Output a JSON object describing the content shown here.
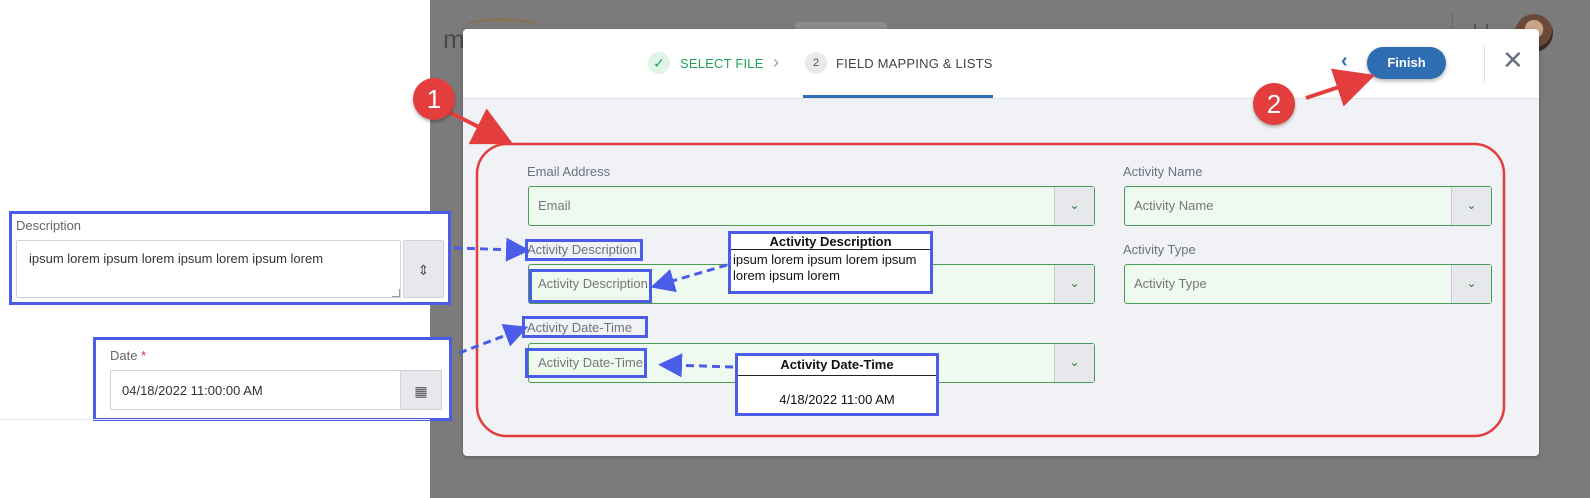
{
  "background_app": {
    "logo_text": "m"
  },
  "wizard": {
    "step1_label": "SELECT FILE",
    "step2_number": "2",
    "step2_label": "FIELD MAPPING & LISTS",
    "finish_label": "Finish"
  },
  "form": {
    "email": {
      "label": "Email Address",
      "placeholder": "Email"
    },
    "activity_name": {
      "label": "Activity Name",
      "placeholder": "Activity Name"
    },
    "activity_description": {
      "label": "Activity Description",
      "placeholder": "Activity Description"
    },
    "activity_type": {
      "label": "Activity Type",
      "placeholder": "Activity Type"
    },
    "activity_datetime": {
      "label": "Activity Date-Time",
      "placeholder": "Activity Date-Time"
    }
  },
  "source_panel": {
    "description_label": "Description",
    "description_value": "ipsum lorem ipsum lorem ipsum lorem ipsum lorem",
    "date_label": "Date",
    "date_required": "*",
    "date_value": "04/18/2022 11:00:00 AM"
  },
  "callouts": {
    "description": {
      "title": "Activity Description",
      "body": "ipsum lorem ipsum lorem ipsum lorem ipsum lorem"
    },
    "datetime": {
      "title": "Activity Date-Time",
      "body": "4/18/2022 11:00 AM"
    }
  },
  "badges": {
    "one": "1",
    "two": "2"
  },
  "colors": {
    "primary": "#2f6db2",
    "success": "#22a55b",
    "annotation_red": "#e43d3d",
    "annotation_blue": "#4a5ce8",
    "mapped_field_bg": "#eefaf0"
  }
}
